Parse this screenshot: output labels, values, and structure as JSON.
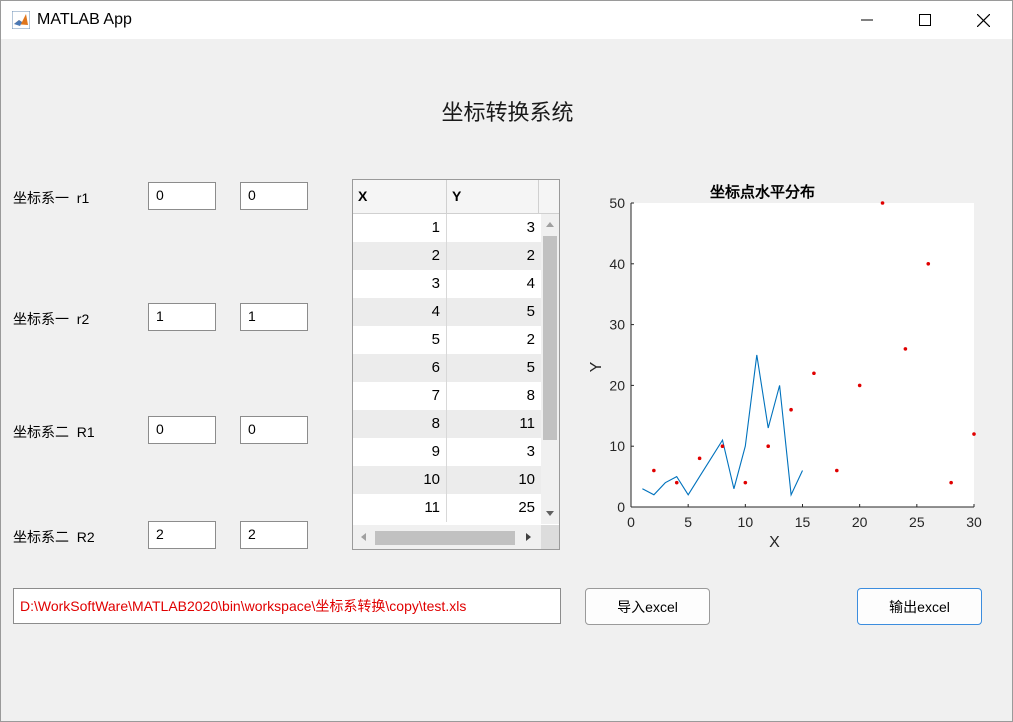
{
  "window": {
    "title": "MATLAB App",
    "controls": [
      "minimize-icon",
      "maximize-icon",
      "close-icon"
    ]
  },
  "main_title": "坐标转换系统",
  "params": [
    {
      "label": "坐标系一  r1",
      "v1": "0",
      "v2": "0"
    },
    {
      "label": "坐标系一  r2",
      "v1": "1",
      "v2": "1"
    },
    {
      "label": "坐标系二  R1",
      "v1": "0",
      "v2": "0"
    },
    {
      "label": "坐标系二  R2",
      "v1": "2",
      "v2": "2"
    }
  ],
  "table": {
    "headers": [
      "X",
      "Y"
    ],
    "rows": [
      [
        "1",
        "3"
      ],
      [
        "2",
        "2"
      ],
      [
        "3",
        "4"
      ],
      [
        "4",
        "5"
      ],
      [
        "5",
        "2"
      ],
      [
        "6",
        "5"
      ],
      [
        "7",
        "8"
      ],
      [
        "8",
        "11"
      ],
      [
        "9",
        "3"
      ],
      [
        "10",
        "10"
      ],
      [
        "11",
        "25"
      ]
    ]
  },
  "file_path": "D:\\WorkSoftWare\\MATLAB2020\\bin\\workspace\\坐标系转换\\copy\\test.xls",
  "buttons": {
    "import": "导入excel",
    "export": "输出excel"
  },
  "colors": {
    "line": "#0072bd",
    "points": "#e00000",
    "path_text": "#e00000",
    "export_border": "#3c8dde"
  },
  "chart_data": {
    "type": "line",
    "title": "坐标点水平分布",
    "xlabel": "X",
    "ylabel": "Y",
    "xlim": [
      0,
      30
    ],
    "ylim": [
      0,
      50
    ],
    "xticks": [
      "0",
      "5",
      "10",
      "15",
      "20",
      "25",
      "30"
    ],
    "yticks": [
      "0",
      "10",
      "20",
      "30",
      "40",
      "50"
    ],
    "series": [
      {
        "style": "line",
        "x": [
          1,
          2,
          3,
          4,
          5,
          6,
          7,
          8,
          9,
          10,
          11,
          12,
          13,
          14,
          15
        ],
        "y": [
          3,
          2,
          4,
          5,
          2,
          5,
          8,
          11,
          3,
          10,
          25,
          13,
          20,
          2,
          6
        ]
      },
      {
        "style": "points",
        "x": [
          2,
          4,
          6,
          8,
          10,
          12,
          14,
          16,
          18,
          20,
          22,
          24,
          26,
          28,
          30
        ],
        "y": [
          6,
          4,
          8,
          10,
          4,
          10,
          16,
          22,
          6,
          20,
          50,
          26,
          40,
          4,
          12
        ]
      }
    ]
  }
}
